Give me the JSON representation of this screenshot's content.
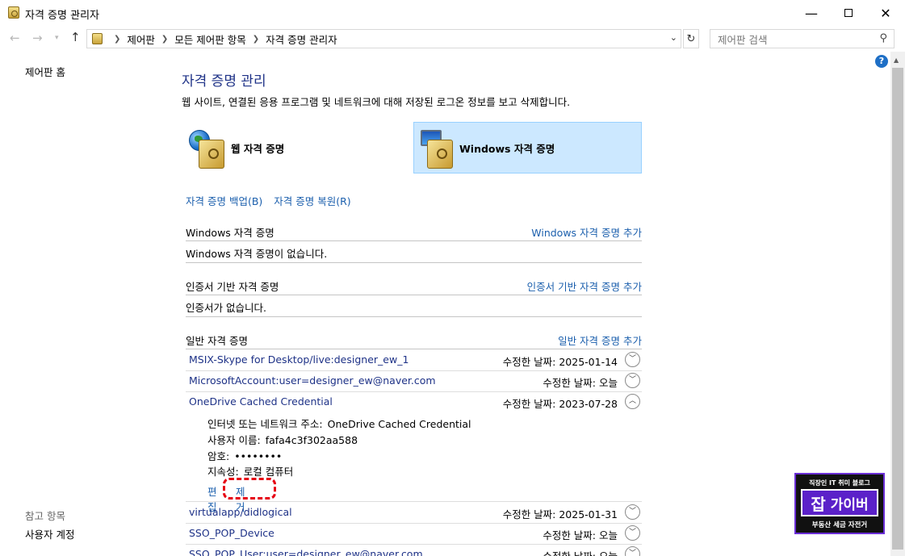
{
  "window": {
    "title": "자격 증명 관리자",
    "controls": {
      "minimize": "—",
      "maximize": "",
      "close": "✕"
    }
  },
  "nav": {
    "breadcrumb": [
      "제어판",
      "모든 제어판 항목",
      "자격 증명 관리자"
    ],
    "search_placeholder": "제어판 검색"
  },
  "left_pane": {
    "home": "제어판 홈",
    "see_also": "참고 항목",
    "user_accounts": "사용자 계정"
  },
  "main": {
    "title": "자격 증명 관리",
    "description": "웹 사이트, 연결된 응용 프로그램 및 네트워크에 대해 저장된 로그온 정보를 보고 삭제합니다.",
    "tiles": [
      {
        "label": "웹 자격 증명",
        "selected": false,
        "icon": "web-vault-icon"
      },
      {
        "label": "Windows 자격 증명",
        "selected": true,
        "icon": "windows-vault-icon"
      }
    ],
    "backup_link": "자격 증명 백업(B)",
    "restore_link": "자격 증명 복원(R)"
  },
  "sections": {
    "windows": {
      "header": "Windows 자격 증명",
      "add": "Windows 자격 증명 추가",
      "empty": "Windows 자격 증명이 없습니다."
    },
    "certificate": {
      "header": "인증서 기반 자격 증명",
      "add": "인증서 기반 자격 증명 추가",
      "empty": "인증서가 없습니다."
    },
    "generic": {
      "header": "일반 자격 증명",
      "add": "일반 자격 증명 추가",
      "items": [
        {
          "name": "MSIX-Skype for Desktop/live:designer_ew_1",
          "date": "수정한 날짜:  2025-01-14",
          "expanded": false
        },
        {
          "name": "MicrosoftAccount:user=designer_ew@naver.com",
          "date": "수정한 날짜:  오늘",
          "expanded": false
        },
        {
          "name": "OneDrive Cached Credential",
          "date": "수정한 날짜:  2023-07-28",
          "expanded": true
        },
        {
          "name": "virtualapp/didlogical",
          "date": "수정한 날짜:  2025-01-31",
          "expanded": false
        },
        {
          "name": "SSO_POP_Device",
          "date": "수정한 날짜:  오늘",
          "expanded": false
        },
        {
          "name": "SSO_POP_User:user=designer_ew@naver.com",
          "date": "수정한 날짜:  오늘",
          "expanded": false
        }
      ],
      "detail": {
        "address_label": "인터넷 또는 네트워크 주소:",
        "address_value": "OneDrive Cached Credential",
        "user_label": "사용자 이름:",
        "user_value": "fafa4c3f302aa588",
        "password_label": "암호:",
        "password_value": "••••••••",
        "persistence_label": "지속성:",
        "persistence_value": "로컬 컴퓨터",
        "edit": "편집",
        "remove": "제거"
      }
    }
  },
  "badge": {
    "top": "직장인 IT 취미 블로그",
    "mid_1": "잡",
    "mid_2": "가이버",
    "bottom": "부동산 세금 자전거"
  },
  "colors": {
    "link": "#1b5fad",
    "heading": "#1e3287",
    "selected_tile": "#cce8ff",
    "highlight": "#e60012",
    "badge_purple": "#5b21c9"
  }
}
